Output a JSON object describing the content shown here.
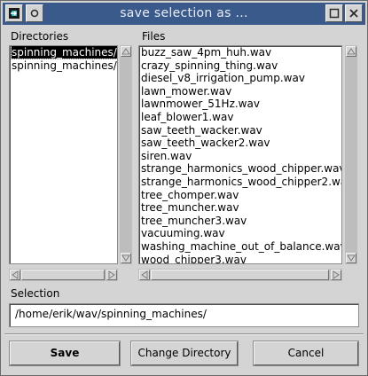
{
  "window": {
    "title": "save selection as ...",
    "accent": "#3a5a8c"
  },
  "titlebar_icons": {
    "left": [
      "app-menu-icon",
      "circle-icon"
    ],
    "right": [
      "maximize-icon",
      "close-icon"
    ]
  },
  "directories": {
    "label": "Directories",
    "items": [
      "spinning_machines/.",
      "spinning_machines/.."
    ],
    "selected_index": 0
  },
  "files": {
    "label": "Files",
    "items": [
      "buzz_saw_4pm_huh.wav",
      "crazy_spinning_thing.wav",
      "diesel_v8_irrigation_pump.wav",
      "lawn_mower.wav",
      "lawnmower_51Hz.wav",
      "leaf_blower1.wav",
      "saw_teeth_wacker.wav",
      "saw_teeth_wacker2.wav",
      "siren.wav",
      "strange_harmonics_wood_chipper.wav",
      "strange_harmonics_wood_chipper2.wav",
      "tree_chomper.wav",
      "tree_muncher.wav",
      "tree_muncher3.wav",
      "vacuuming.wav",
      "washing_machine_out_of_balance.wav",
      "wood_chipper3.wav"
    ]
  },
  "selection": {
    "label": "Selection",
    "value": "/home/erik/wav/spinning_machines/"
  },
  "buttons": {
    "save": "Save",
    "change_directory": "Change Directory",
    "cancel": "Cancel"
  }
}
